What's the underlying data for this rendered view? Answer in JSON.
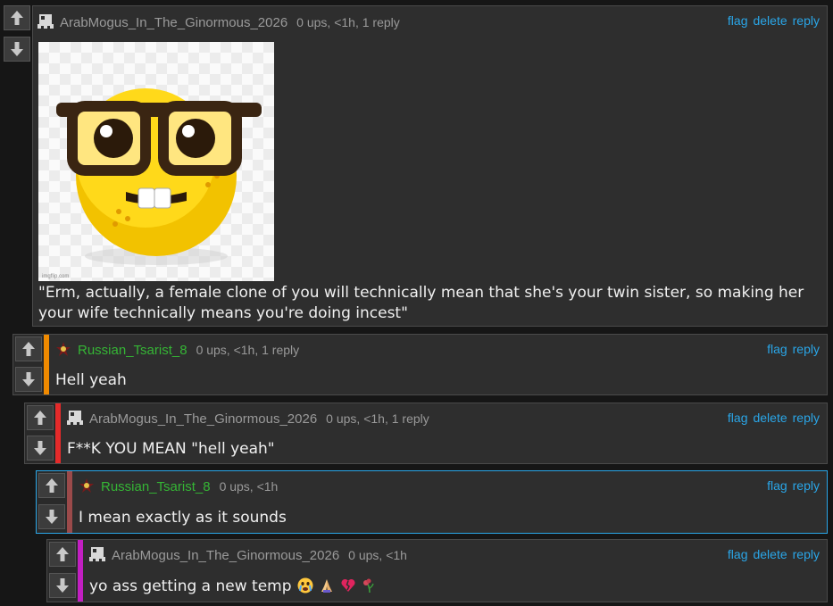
{
  "comments": [
    {
      "username": "ArabMogus_In_The_Ginormous_2026",
      "meta": "0 ups, <1h, 1 reply",
      "actions": [
        "flag",
        "delete",
        "reply"
      ],
      "image_watermark": "imgflip.com",
      "text": "\"Erm, actually, a female clone of you will technically mean that she's your twin sister, so making her your wife technically means you're doing incest\""
    },
    {
      "username": "Russian_Tsarist_8",
      "meta": "0 ups, <1h, 1 reply",
      "actions": [
        "flag",
        "reply"
      ],
      "text": "Hell yeah",
      "stripe_color": "#f08a00"
    },
    {
      "username": "ArabMogus_In_The_Ginormous_2026",
      "meta": "0 ups, <1h, 1 reply",
      "actions": [
        "flag",
        "delete",
        "reply"
      ],
      "text": "F**K YOU MEAN \"hell yeah\"",
      "stripe_color": "#e52a2a"
    },
    {
      "username": "Russian_Tsarist_8",
      "meta": "0 ups, <1h",
      "actions": [
        "flag",
        "reply"
      ],
      "text": "I mean exactly as it sounds",
      "stripe_color": "#9b4a4a",
      "highlight_border": "#2aa6e8"
    },
    {
      "username": "ArabMogus_In_The_Ginormous_2026",
      "meta": "0 ups, <1h",
      "actions": [
        "flag",
        "delete",
        "reply"
      ],
      "text": "yo ass getting a new temp",
      "emojis": [
        "crying-face",
        "folded-hands",
        "broken-heart",
        "wilted-flower"
      ],
      "stripe_color": "#c21fc2"
    }
  ]
}
